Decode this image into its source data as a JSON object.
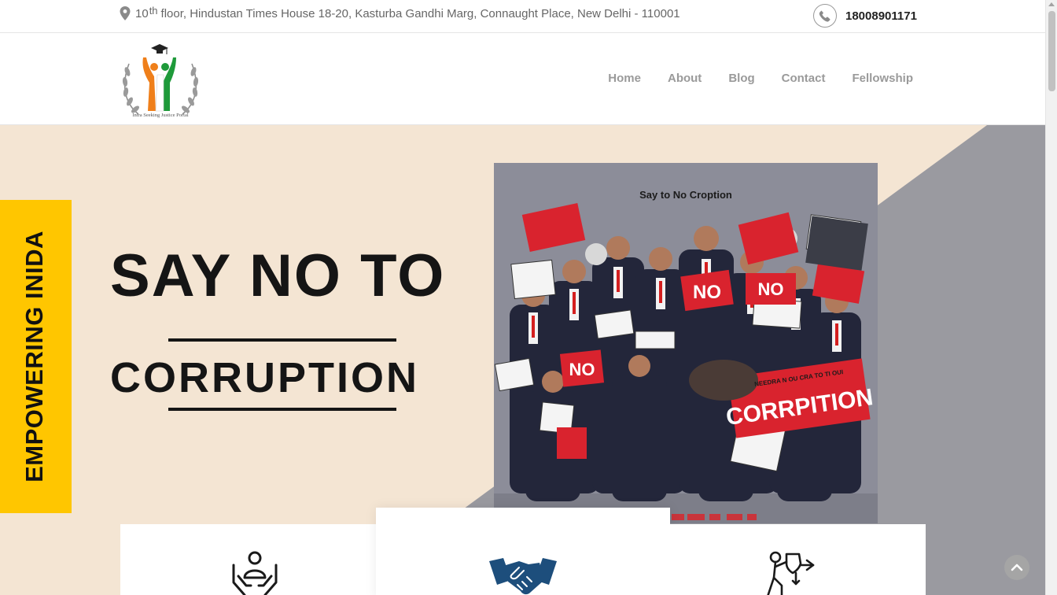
{
  "topbar": {
    "address_prefix": "10",
    "address_sup": "th",
    "address_rest": "floor, Hindustan Times House 18-20, Kasturba Gandhi Marg, Connaught Place, New Delhi - 110001",
    "address_icon": "map-pin-icon",
    "phone_icon": "phone-icon",
    "phone_number": "18008901171"
  },
  "logo": {
    "caption": "Intra Seeking Justice Portal"
  },
  "nav": {
    "items": [
      {
        "label": "Home"
      },
      {
        "label": "About"
      },
      {
        "label": "Blog"
      },
      {
        "label": "Contact"
      },
      {
        "label": "Fellowship"
      }
    ]
  },
  "hero": {
    "side_label": "EMPOWERING INIDA",
    "headline_line1": "SAY NO TO",
    "headline_line2": "CORRUPTION",
    "poster": {
      "title": "Say to No Croption",
      "sign_no_1": "NO",
      "sign_no_2": "NO",
      "sign_no_3": "NO",
      "banner_small": "NEEDRA N OU CRA TO TI OUI",
      "banner_big": "CORRPITION"
    },
    "colors": {
      "background": "#f4e5d3",
      "band": "#ffc600",
      "diagonal": "#9a9aa0"
    }
  },
  "features": [
    {
      "icon": "care-hands-icon"
    },
    {
      "icon": "handshake-icon"
    },
    {
      "icon": "justice-figure-icon"
    }
  ],
  "ui": {
    "back_to_top_icon": "chevron-up-icon"
  }
}
